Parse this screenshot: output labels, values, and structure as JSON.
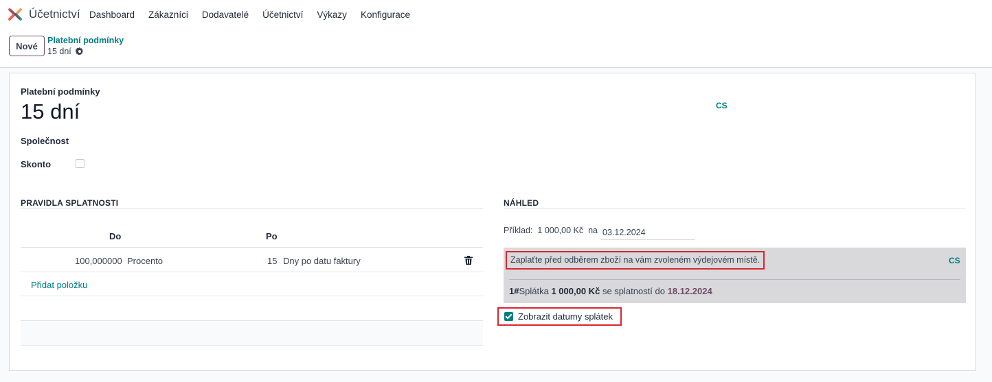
{
  "navbar": {
    "app_name": "Účetnictví",
    "menu": [
      "Dashboard",
      "Zákazníci",
      "Dodavatelé",
      "Účetnictví",
      "Výkazy",
      "Konfigurace"
    ]
  },
  "control_panel": {
    "new_label": "Nové",
    "breadcrumb_parent": "Platební podmínky",
    "breadcrumb_current": "15 dní"
  },
  "form": {
    "name_label": "Platební podmínky",
    "name_value": "15 dní",
    "language_code": "CS",
    "company_label": "Společnost",
    "skonto_label": "Skonto",
    "skonto_checked": false
  },
  "rules": {
    "title": "PRAVIDLA SPLATNOSTI",
    "columns": [
      "Do",
      "Po"
    ],
    "rows": [
      {
        "value": "100,000000",
        "value_type": "Procento",
        "days": "15",
        "delay_type": "Dny po datu faktury"
      }
    ],
    "add_line": "Přidat položku"
  },
  "preview": {
    "title": "NÁHLED",
    "example_label": "Příklad:",
    "example_amount": "1 000,00 Kč",
    "example_on": "na",
    "example_date": "03.12.2024",
    "note": "Zaplaťte před odběrem zboží na vám zvoleném výdejovém místě.",
    "note_lang": "CS",
    "installment": {
      "number": "1#",
      "label": "Splátka",
      "amount": "1 000,00 Kč",
      "due_text": "se splatností do",
      "due_date": "18.12.2024"
    },
    "show_dates_label": "Zobrazit datumy splátek",
    "show_dates_checked": true
  },
  "colors": {
    "accent_teal": "#017e84",
    "primary_purple": "#714b67",
    "highlight_red": "#d7262e"
  }
}
